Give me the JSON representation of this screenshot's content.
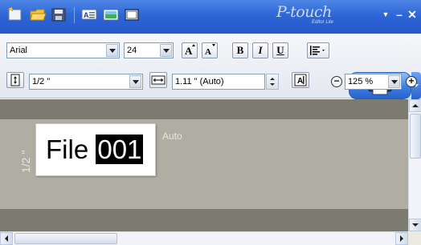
{
  "app": {
    "brand_logo": "P-touch",
    "brand_subtitle": "Editor Lite"
  },
  "toolbar": {
    "font_name": "Arial",
    "font_size": "24",
    "bold_label": "B",
    "italic_label": "I",
    "underline_label": "U",
    "tape_width": "1/2 \"",
    "tape_length": "1.11 \" (Auto)",
    "zoom_value": "125 %",
    "zoom_out_label": "−",
    "zoom_in_label": "+"
  },
  "canvas": {
    "label_text_plain": "File ",
    "label_text_selected": "001",
    "length_caption": "Auto",
    "width_caption": "1/2 \""
  },
  "colors": {
    "titlebar": "#2e66d6",
    "canvas_bg": "#7d7a70",
    "label_strip": "#b0ada3",
    "print_button": "#3b7fe6"
  }
}
